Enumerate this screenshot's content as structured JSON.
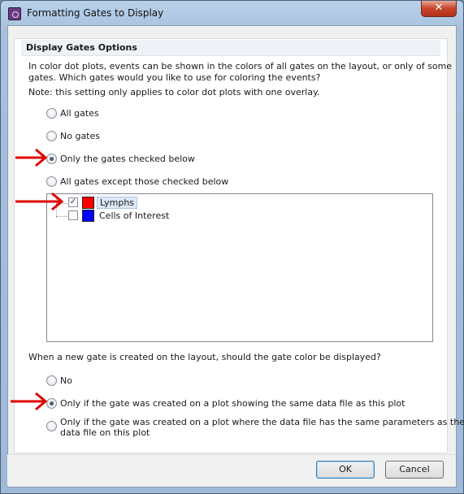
{
  "window": {
    "title": "Formatting Gates to Display",
    "close_label": "✕"
  },
  "group": {
    "header": "Display Gates Options",
    "description_line1": "In color dot plots, events can be shown in the colors of all gates on the layout, or only of some",
    "description_line2": "gates. Which gates would you like to use for coloring the events?",
    "note": "Note: this setting only applies to color dot plots with one overlay."
  },
  "gate_options": [
    {
      "label": "All gates",
      "selected": false
    },
    {
      "label": "No gates",
      "selected": false
    },
    {
      "label": "Only the gates checked below",
      "selected": true
    },
    {
      "label": "All gates except those checked below",
      "selected": false
    }
  ],
  "gate_list": [
    {
      "label": "Lymphs",
      "checked": true,
      "color": "#ff0000"
    },
    {
      "label": "Cells of Interest",
      "checked": false,
      "color": "#0000ff"
    }
  ],
  "new_gate": {
    "question": "When a new gate is created on the layout, should the gate color be displayed?",
    "options": [
      {
        "label": "No",
        "selected": false
      },
      {
        "label": "Only if the gate was created on a plot showing the same data file as this plot",
        "selected": true
      },
      {
        "label_line1": "Only if the gate was created on a plot where the data file has the same parameters as the",
        "label_line2": "data file on this plot",
        "selected": false
      }
    ]
  },
  "buttons": {
    "ok": "OK",
    "cancel": "Cancel"
  },
  "colors": {
    "annotation_arrow": "#e00000"
  }
}
